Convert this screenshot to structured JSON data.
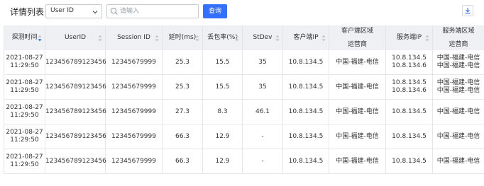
{
  "header": {
    "title": "详情列表",
    "select_value": "User ID",
    "search_placeholder": "请输入",
    "query_label": "查询"
  },
  "columns": [
    {
      "lines": [
        "探测时间"
      ],
      "sort": "active"
    },
    {
      "lines": [
        "UserID"
      ],
      "sort": "both"
    },
    {
      "lines": [
        "Session ID"
      ],
      "sort": "both"
    },
    {
      "lines": [
        "延时(ms)"
      ],
      "sort": "both"
    },
    {
      "lines": [
        "丢包率(%)"
      ],
      "sort": "both"
    },
    {
      "lines": [
        "StDev"
      ],
      "sort": "both"
    },
    {
      "lines": [
        "客户端IP"
      ],
      "sort": "both"
    },
    {
      "lines": [
        "客户端区域",
        "运营商"
      ],
      "sort": "none"
    },
    {
      "lines": [
        "服务端IP"
      ],
      "sort": "both"
    },
    {
      "lines": [
        "服务端区域",
        "运营商"
      ],
      "sort": "none"
    }
  ],
  "rows": [
    {
      "time": [
        "2021-08-27",
        "11:29:50"
      ],
      "user": "123456789123456",
      "session": "12345679999",
      "delay": "25.3",
      "loss": "15.5",
      "stdev": "35",
      "cip": "10.8.134.5",
      "cregion": [
        "中国-福建-电信"
      ],
      "sip": [
        "10.8.134.5",
        "10.8.134.6"
      ],
      "sregion": [
        "中国-福建-电信",
        "中国-福建-电信"
      ]
    },
    {
      "time": [
        "2021-08-27",
        "11:29:50"
      ],
      "user": "123456789123456",
      "session": "12345679999",
      "delay": "25.3",
      "loss": "15.5",
      "stdev": "35",
      "cip": "10.8.134.5",
      "cregion": [
        "中国-福建-电信"
      ],
      "sip": [
        "10.8.134.5",
        "10.8.134.6"
      ],
      "sregion": [
        "中国-福建-电信",
        "中国-福建-电信"
      ]
    },
    {
      "time": [
        "2021-08-27",
        "11:29:50"
      ],
      "user": "123456789123456",
      "session": "12345679999",
      "delay": "27.3",
      "loss": "8.3",
      "stdev": "46.1",
      "cip": "10.8.134.5",
      "cregion": [
        "中国-福建-电信"
      ],
      "sip": [
        "10.8.134.5"
      ],
      "sregion": [
        "中国-福建-电信"
      ]
    },
    {
      "time": [
        "2021-08-27",
        "11:29:50"
      ],
      "user": "123456789123456",
      "session": "12345679999",
      "delay": "66.3",
      "loss": "12.9",
      "stdev": "-",
      "cip": "10.8.134.5",
      "cregion": [
        "中国-福建-电信"
      ],
      "sip": [
        "10.8.134.5"
      ],
      "sregion": [
        "中国-福建-电信"
      ]
    },
    {
      "time": [
        "2021-08-27",
        "11:29:50"
      ],
      "user": "123456789123456",
      "session": "12345679999",
      "delay": "66.3",
      "loss": "12.9",
      "stdev": "-",
      "cip": "10.8.134.5",
      "cregion": [
        "中国-福建-电信"
      ],
      "sip": [
        "10.8.134.5"
      ],
      "sregion": [
        "中国-福建-电信"
      ]
    }
  ],
  "colors": {
    "accent": "#3370ff",
    "header_bg": "#eef0f3"
  },
  "icons": {
    "select": "chevron-down-icon",
    "search": "search-icon",
    "download": "download-icon",
    "sort": "sort-icon"
  }
}
